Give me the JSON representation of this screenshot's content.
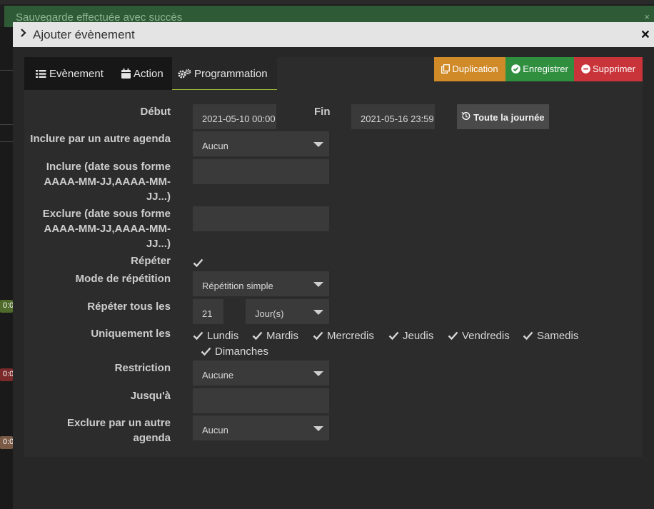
{
  "toast": {
    "message": "Sauvegarde effectuée avec succès",
    "close": "×"
  },
  "modal": {
    "title": "Ajouter évènement",
    "close": "×"
  },
  "tabs": [
    {
      "label": "Evènement",
      "icon": "list-icon"
    },
    {
      "label": "Action",
      "icon": "calendar-icon"
    },
    {
      "label": "Programmation",
      "icon": "gears-icon"
    }
  ],
  "actions": {
    "duplicate": "Duplication",
    "save": "Enregistrer",
    "delete": "Supprimer"
  },
  "form": {
    "start_label": "Début",
    "start_value": "2021-05-10 00:00",
    "end_label": "Fin",
    "end_value": "2021-05-16 23:59",
    "allday_label": "Toute la journée",
    "include_agenda_label": "Inclure par un autre agenda",
    "include_agenda_value": "Aucun",
    "include_dates_label": [
      "Inclure (date sous forme",
      "AAAA-MM-JJ,AAAA-MM-",
      "JJ...)"
    ],
    "include_dates_value": "",
    "exclude_dates_label": [
      "Exclure (date sous forme",
      "AAAA-MM-JJ,AAAA-MM-",
      "JJ...)"
    ],
    "exclude_dates_value": "",
    "repeat_label": "Répéter",
    "repeat_checked": true,
    "repeat_mode_label": "Mode de répétition",
    "repeat_mode_value": "Répétition simple",
    "repeat_every_label": "Répéter tous les",
    "repeat_every_value": "21",
    "repeat_unit_value": "Jour(s)",
    "only_label": "Uniquement les",
    "days": [
      "Lundis",
      "Mardis",
      "Mercredis",
      "Jeudis",
      "Vendredis",
      "Samedis",
      "Dimanches"
    ],
    "restriction_label": "Restriction",
    "restriction_value": "Aucune",
    "until_label": "Jusqu'à",
    "until_value": "",
    "exclude_agenda_label": [
      "Exclure par un autre",
      "agenda"
    ],
    "exclude_agenda_value": "Aucun"
  },
  "background": {
    "chips": [
      "0:0",
      "0:0",
      "0:0"
    ]
  },
  "colors": {
    "toast": "#2e5a35",
    "duplicate": "#d08a28",
    "save": "#2f8f3f",
    "delete": "#c9343a",
    "tab_underline": "#a7c43f"
  }
}
